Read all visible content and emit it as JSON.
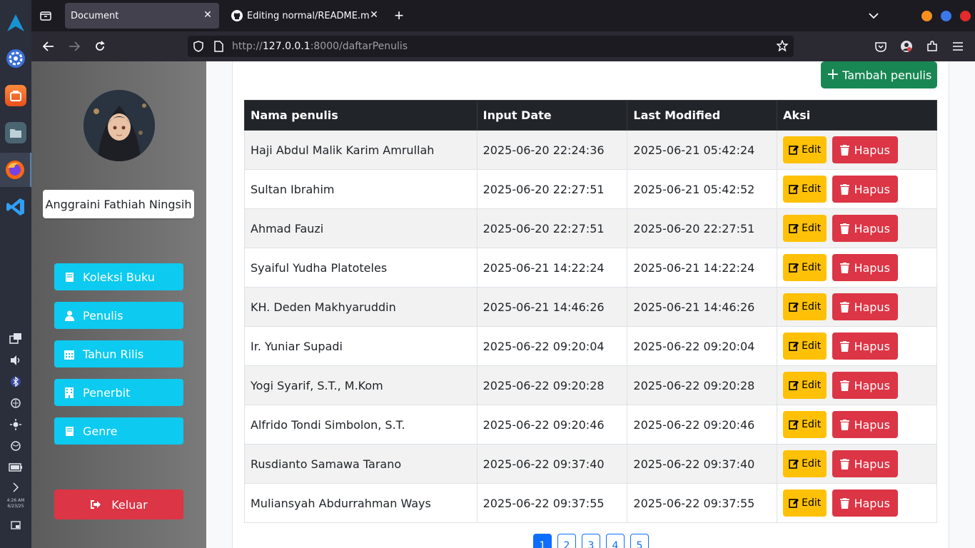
{
  "dock": {
    "clock_time": "4:26 AM",
    "clock_date": "6/23/25"
  },
  "browser": {
    "tabs": [
      {
        "label": "Document"
      },
      {
        "label": "Editing normal/README.m"
      }
    ],
    "url_prefix": "http://",
    "url_host": "127.0.0.1",
    "url_rest": ":8000/daftarPenulis"
  },
  "sidebar": {
    "username": "Anggraini Fathiah Ningsih",
    "nav": [
      {
        "label": "Koleksi Buku",
        "icon": "book-icon"
      },
      {
        "label": "Penulis",
        "icon": "user-icon"
      },
      {
        "label": "Tahun Rilis",
        "icon": "calendar-icon"
      },
      {
        "label": "Penerbit",
        "icon": "building-icon"
      },
      {
        "label": "Genre",
        "icon": "book-icon"
      }
    ],
    "logout_label": "Keluar"
  },
  "main": {
    "add_label": "Tambah penulis",
    "table": {
      "headers": [
        "Nama penulis",
        "Input Date",
        "Last Modified",
        "Aksi"
      ],
      "edit_label": "Edit",
      "delete_label": "Hapus",
      "rows": [
        [
          "Haji Abdul Malik Karim Amrullah",
          "2025-06-20 22:24:36",
          "2025-06-21 05:42:24"
        ],
        [
          "Sultan Ibrahim",
          "2025-06-20 22:27:51",
          "2025-06-21 05:42:52"
        ],
        [
          "Ahmad Fauzi",
          "2025-06-20 22:27:51",
          "2025-06-20 22:27:51"
        ],
        [
          "Syaiful Yudha Platoteles",
          "2025-06-21 14:22:24",
          "2025-06-21 14:22:24"
        ],
        [
          "KH. Deden Makhyaruddin",
          "2025-06-21 14:46:26",
          "2025-06-21 14:46:26"
        ],
        [
          "Ir. Yuniar Supadi",
          "2025-06-22 09:20:04",
          "2025-06-22 09:20:04"
        ],
        [
          "Yogi Syarif, S.T., M.Kom",
          "2025-06-22 09:20:28",
          "2025-06-22 09:20:28"
        ],
        [
          "Alfrido Tondi Simbolon, S.T.",
          "2025-06-22 09:20:46",
          "2025-06-22 09:20:46"
        ],
        [
          "Rusdianto Samawa Tarano",
          "2025-06-22 09:37:40",
          "2025-06-22 09:37:40"
        ],
        [
          "Muliansyah Abdurrahman Ways",
          "2025-06-22 09:37:55",
          "2025-06-22 09:37:55"
        ]
      ]
    },
    "pages": [
      "1",
      "2",
      "3",
      "4",
      "5"
    ],
    "active_page": "1"
  },
  "colors": {
    "nav": "#0dcaf0",
    "add": "#198754",
    "edit": "#ffc107",
    "delete": "#dc3545",
    "primary": "#0d6efd"
  }
}
